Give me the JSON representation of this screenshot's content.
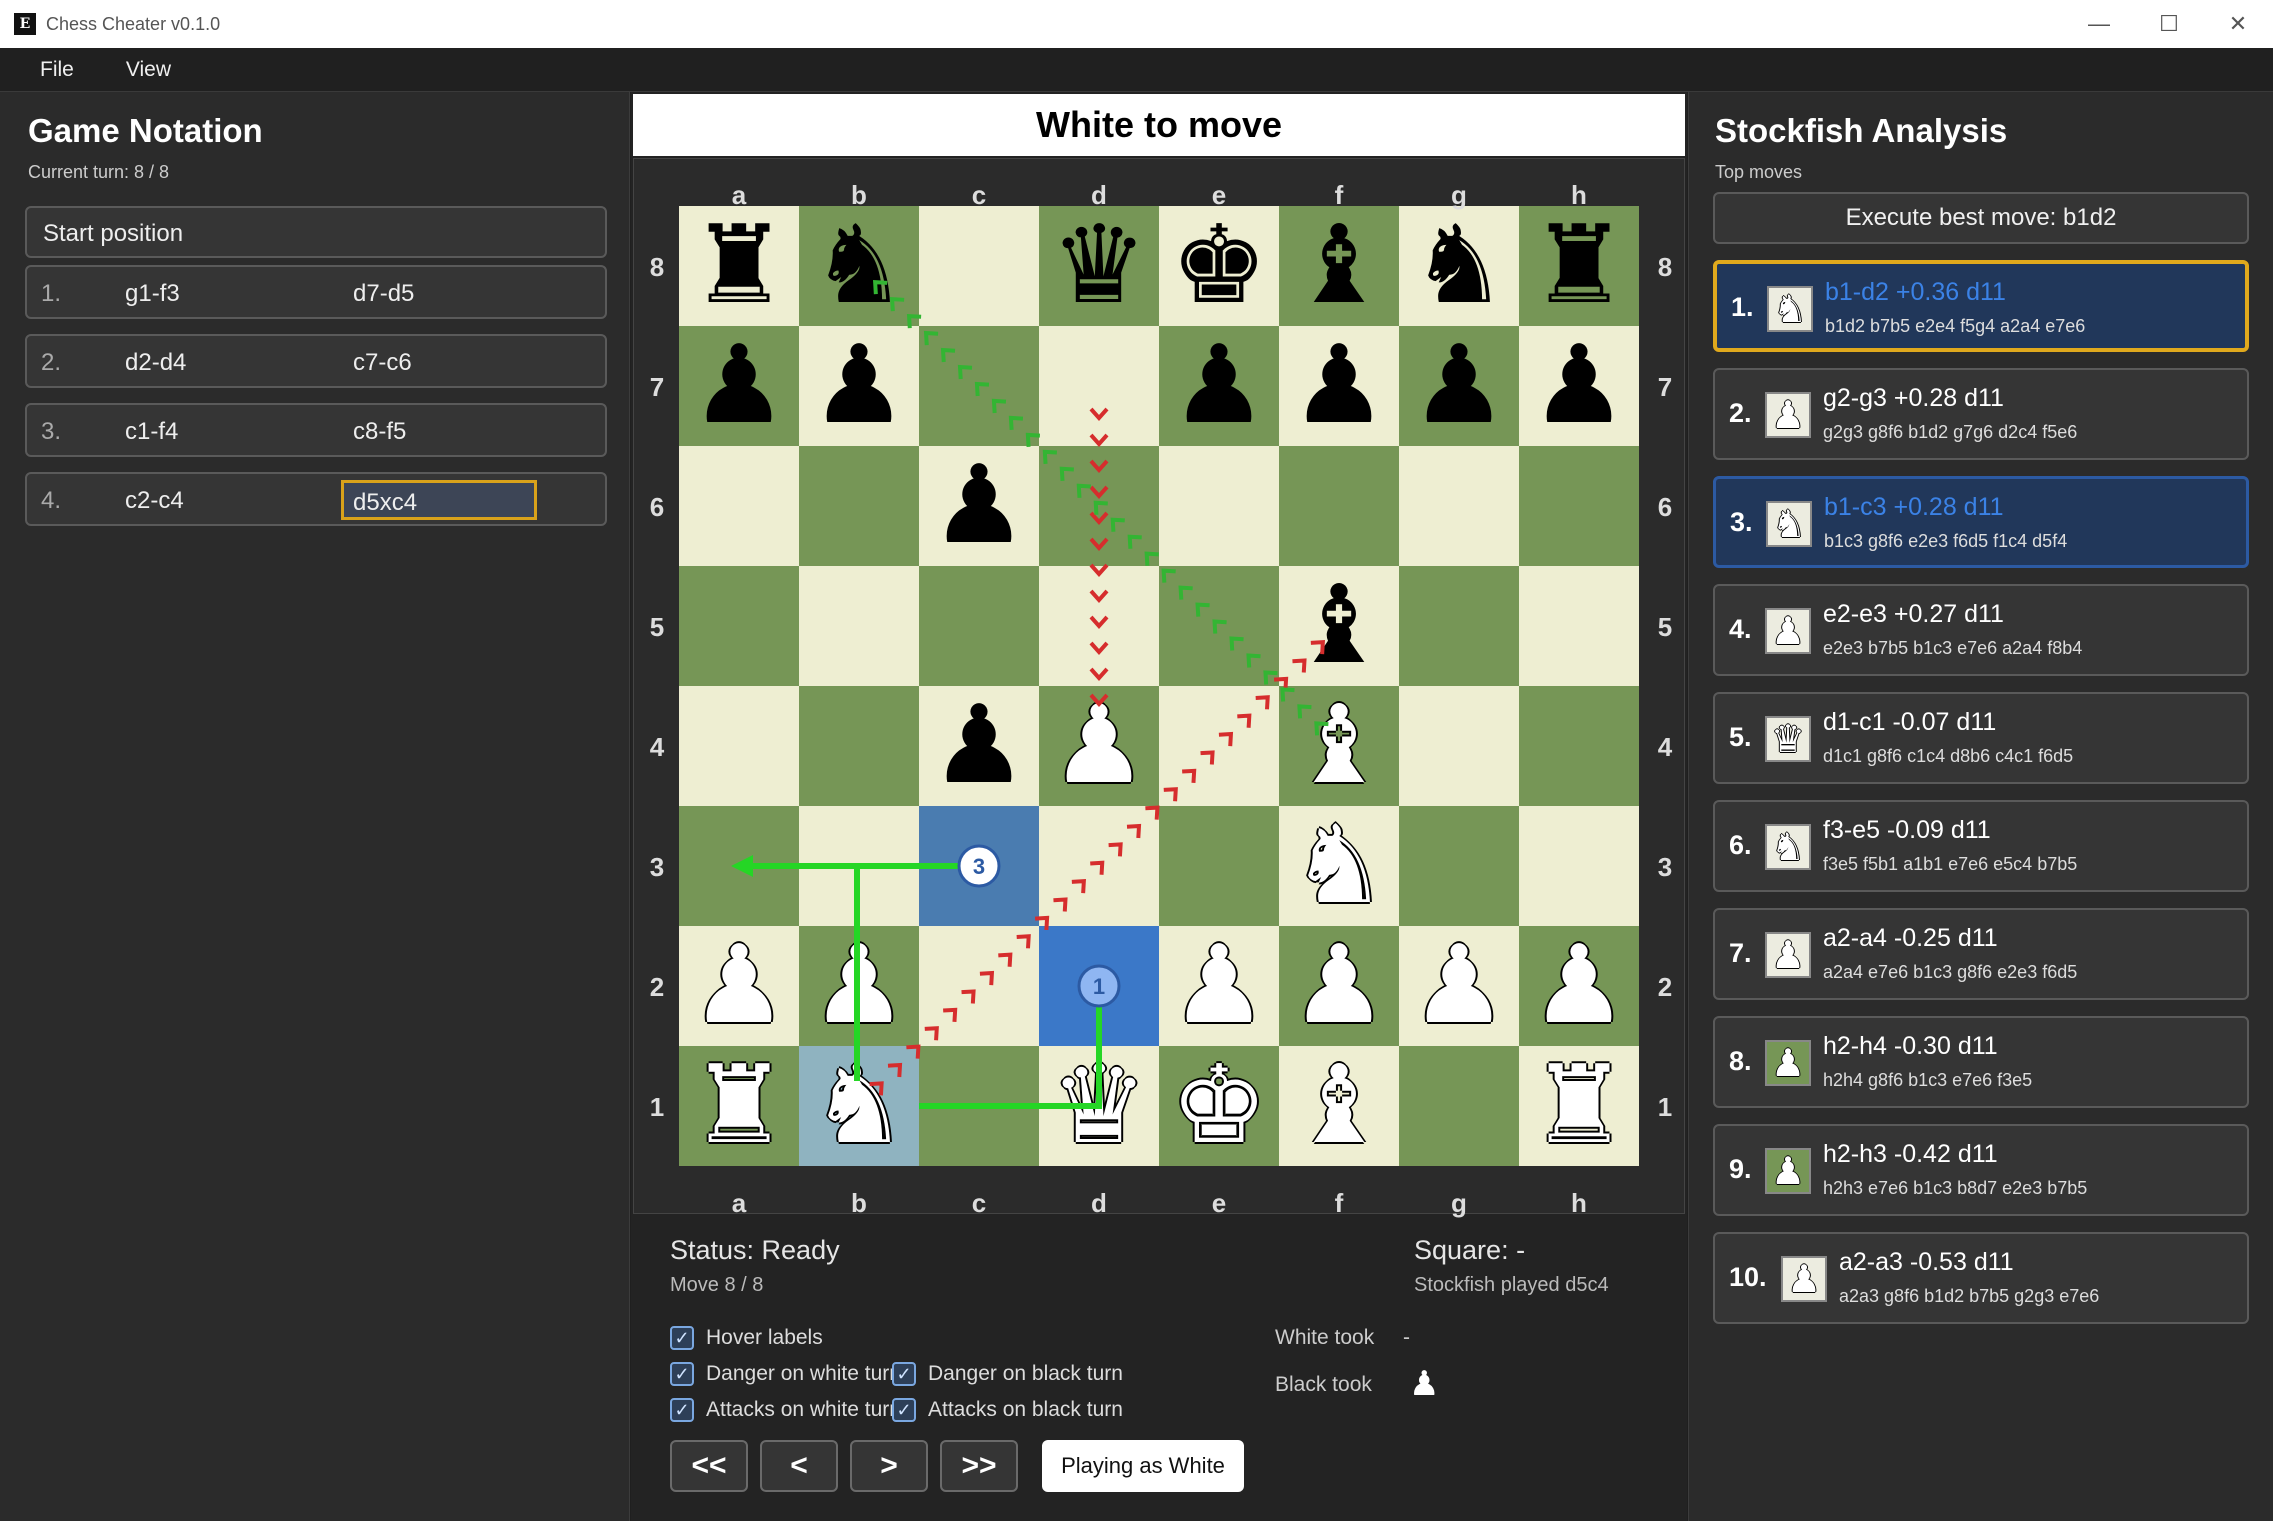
{
  "window": {
    "title": "Chess Cheater v0.1.0",
    "icon": "app-logo-icon"
  },
  "menu": {
    "file": "File",
    "view": "View"
  },
  "notation": {
    "title": "Game Notation",
    "current_turn": "Current turn: 8 / 8",
    "start": "Start position",
    "moves": [
      {
        "num": "1.",
        "white": "g1-f3",
        "black": "d7-d5"
      },
      {
        "num": "2.",
        "white": "d2-d4",
        "black": "c7-c6"
      },
      {
        "num": "3.",
        "white": "c1-f4",
        "black": "c8-f5"
      },
      {
        "num": "4.",
        "white": "c2-c4",
        "black": "d5xc4"
      }
    ]
  },
  "board": {
    "banner": "White to move",
    "files": [
      "a",
      "b",
      "c",
      "d",
      "e",
      "f",
      "g",
      "h"
    ],
    "ranks": [
      "8",
      "7",
      "6",
      "5",
      "4",
      "3",
      "2",
      "1"
    ],
    "light_color": "#eeeed2",
    "dark_color": "#769656",
    "pieces": {
      "a8": "br",
      "b8": "bn",
      "d8": "bq",
      "e8": "bk",
      "f8": "bb",
      "g8": "bn",
      "h8": "br",
      "a7": "bp",
      "b7": "bp",
      "e7": "bp",
      "f7": "bp",
      "g7": "bp",
      "h7": "bp",
      "c6": "bp",
      "f5": "bb",
      "c4": "bp",
      "d4": "wp",
      "f4": "wb",
      "f3": "wn",
      "a2": "wp",
      "b2": "wp",
      "e2": "wp",
      "f2": "wp",
      "g2": "wp",
      "h2": "wp",
      "a1": "wr",
      "b1": "wn",
      "d1": "wq",
      "e1": "wk",
      "f1": "wb",
      "h1": "wr"
    },
    "highlights": {
      "b1": "#8fb3c0",
      "c3": "#4a7cb0",
      "d2": "#3b78c8"
    },
    "markers": [
      {
        "square": "c3",
        "label": "3"
      },
      {
        "square": "d2",
        "label": "1"
      }
    ]
  },
  "status": {
    "status": "Status: Ready",
    "move": "Move 8 / 8",
    "square": "Square: -",
    "engine": "Stockfish played d5c4",
    "white_took_label": "White took",
    "white_took_value": "-",
    "black_took_label": "Black took",
    "black_took_icon": "white-pawn-icon",
    "checkboxes": {
      "hover": "Hover labels",
      "danger_white": "Danger on white turn",
      "danger_black": "Danger on black turn",
      "attacks_white": "Attacks on white turn",
      "attacks_black": "Attacks on black turn"
    },
    "nav": {
      "first": "<<",
      "prev": "<",
      "next": ">",
      "last": ">>"
    },
    "playing_as": "Playing as White"
  },
  "analysis": {
    "title": "Stockfish Analysis",
    "subtitle": "Top moves",
    "execute": "Execute best move: b1d2",
    "moves": [
      {
        "rank": "1.",
        "piece": "knight",
        "head": "b1-d2  +0.36  d11",
        "pv": "b1d2 b7b5 e2e4 f5g4 a2a4 e7e6"
      },
      {
        "rank": "2.",
        "piece": "pawn",
        "head": "g2-g3  +0.28  d11",
        "pv": "g2g3 g8f6 b1d2 g7g6 d2c4 f5e6"
      },
      {
        "rank": "3.",
        "piece": "knight",
        "head": "b1-c3  +0.28  d11",
        "pv": "b1c3 g8f6 e2e3 f6d5 f1c4 d5f4"
      },
      {
        "rank": "4.",
        "piece": "pawn",
        "head": "e2-e3  +0.27  d11",
        "pv": "e2e3 b7b5 b1c3 e7e6 a2a4 f8b4"
      },
      {
        "rank": "5.",
        "piece": "queen",
        "head": "d1-c1  -0.07  d11",
        "pv": "d1c1 g8f6 c1c4 d8b6 c4c1 f6d5"
      },
      {
        "rank": "6.",
        "piece": "knight",
        "head": "f3-e5  -0.09  d11",
        "pv": "f3e5 f5b1 a1b1 e7e6 e5c4 b7b5"
      },
      {
        "rank": "7.",
        "piece": "pawn",
        "head": "a2-a4  -0.25  d11",
        "pv": "a2a4 e7e6 b1c3 g8f6 e2e3 f6d5"
      },
      {
        "rank": "8.",
        "piece": "pawn",
        "head": "h2-h4  -0.30  d11",
        "pv": "h2h4 g8f6 b1c3 e7e6 f3e5"
      },
      {
        "rank": "9.",
        "piece": "pawn",
        "head": "h2-h3  -0.42  d11",
        "pv": "h2h3 e7e6 b1c3 b8d7 e2e3 b7b5"
      },
      {
        "rank": "10.",
        "piece": "pawn",
        "head": "a2-a3  -0.53  d11",
        "pv": "a2a3 g8f6 b1d2 b7b5 g2g3 e7e6"
      }
    ]
  }
}
